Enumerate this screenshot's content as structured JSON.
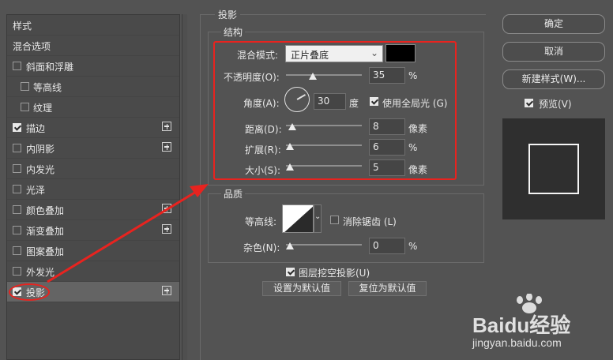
{
  "left_panel": {
    "header": "样式",
    "blend_options": "混合选项",
    "items": [
      {
        "label": "斜面和浮雕",
        "checked": false,
        "has_add": false
      },
      {
        "label": "等高线",
        "checked": false,
        "has_add": false
      },
      {
        "label": "纹理",
        "checked": false,
        "has_add": false
      },
      {
        "label": "描边",
        "checked": true,
        "has_add": true
      },
      {
        "label": "内阴影",
        "checked": false,
        "has_add": true
      },
      {
        "label": "内发光",
        "checked": false,
        "has_add": false
      },
      {
        "label": "光泽",
        "checked": false,
        "has_add": false
      },
      {
        "label": "颜色叠加",
        "checked": false,
        "has_add": true
      },
      {
        "label": "渐变叠加",
        "checked": false,
        "has_add": true
      },
      {
        "label": "图案叠加",
        "checked": false,
        "has_add": false
      },
      {
        "label": "外发光",
        "checked": false,
        "has_add": false
      },
      {
        "label": "投影",
        "checked": true,
        "has_add": true
      }
    ]
  },
  "main": {
    "section_title": "投影",
    "structure": {
      "title": "结构",
      "blend_mode_label": "混合模式:",
      "blend_mode_value": "正片叠底",
      "blend_color": "#000000",
      "opacity_label": "不透明度(O):",
      "opacity_value": "35",
      "opacity_unit": "%",
      "angle_label": "角度(A):",
      "angle_value": "30",
      "angle_unit": "度",
      "global_light_label": "使用全局光 (G)",
      "global_light_checked": true,
      "distance_label": "距离(D):",
      "distance_value": "8",
      "distance_unit": "像素",
      "spread_label": "扩展(R):",
      "spread_value": "6",
      "spread_unit": "%",
      "size_label": "大小(S):",
      "size_value": "5",
      "size_unit": "像素"
    },
    "quality": {
      "title": "品质",
      "contour_label": "等高线:",
      "anti_alias_label": "消除锯齿 (L)",
      "anti_alias_checked": false,
      "noise_label": "杂色(N):",
      "noise_value": "0",
      "noise_unit": "%"
    },
    "knockout_label": "图层挖空投影(U)",
    "knockout_checked": true,
    "make_default": "设置为默认值",
    "reset_default": "复位为默认值"
  },
  "right_panel": {
    "ok": "确定",
    "cancel": "取消",
    "new_style": "新建样式(W)...",
    "preview_label": "预览(V)",
    "preview_checked": true
  },
  "watermark": {
    "brand": "Baidu经验",
    "url": "jingyan.baidu.com"
  },
  "colors": {
    "highlight": "#e8231f",
    "panel": "#535353"
  }
}
